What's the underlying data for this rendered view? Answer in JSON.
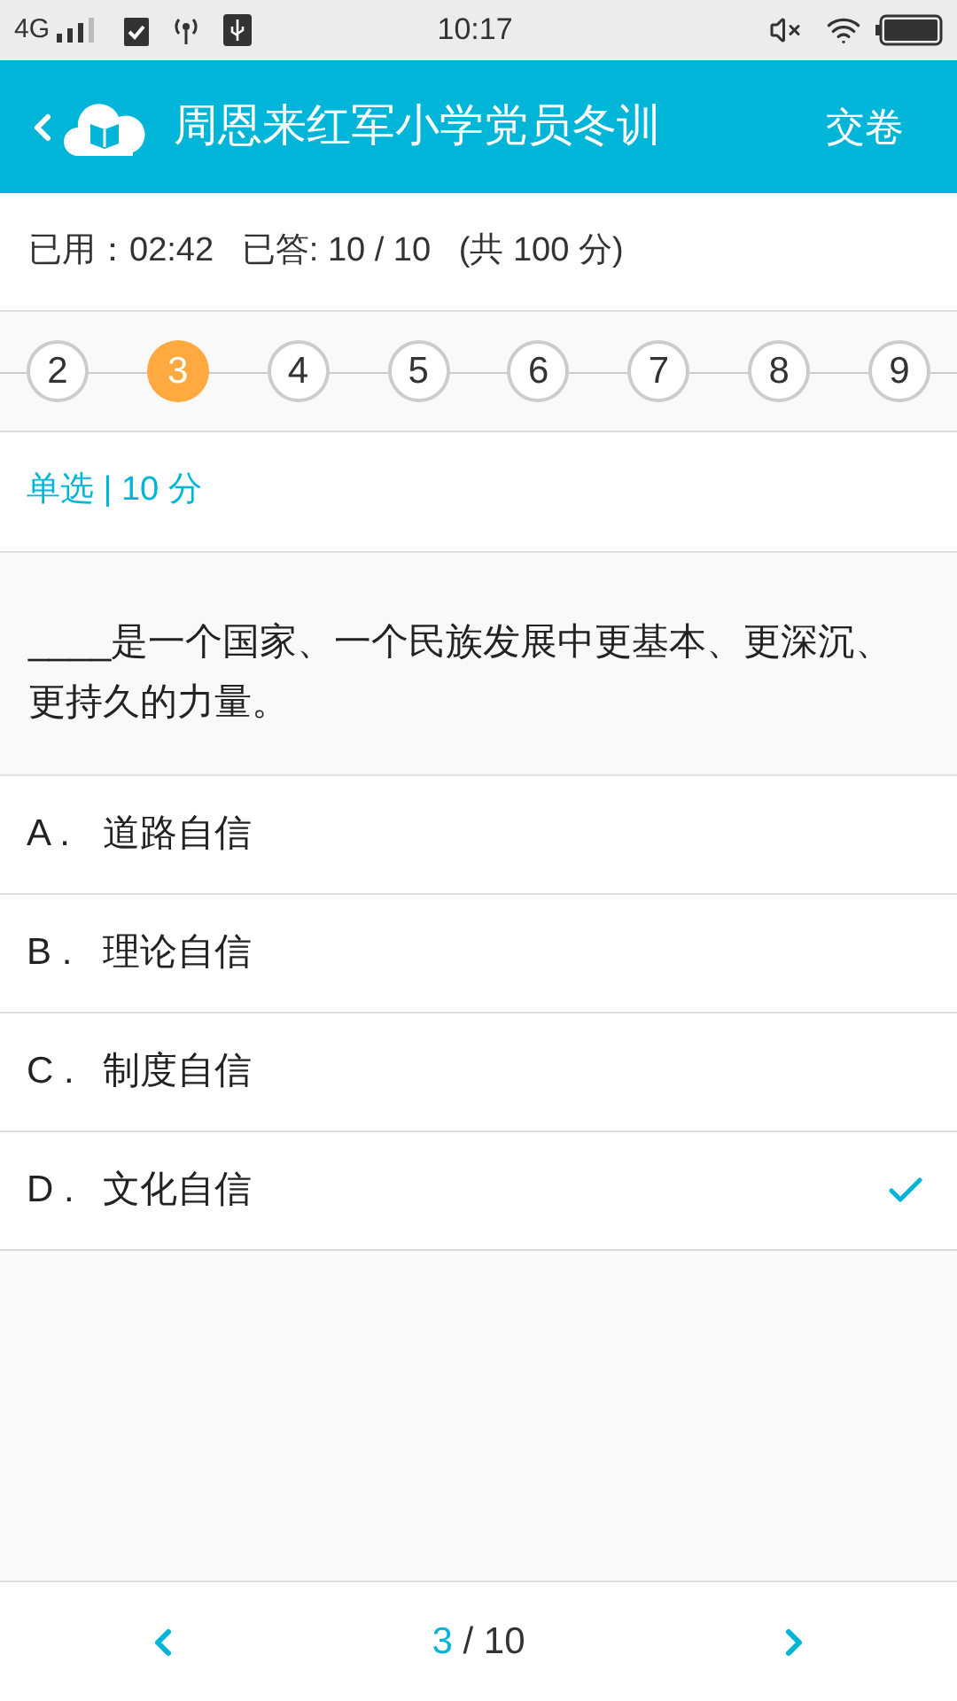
{
  "status_bar": {
    "network": "4G",
    "time": "10:17"
  },
  "header": {
    "title": "周恩来红军小学党员冬训",
    "action": "交卷"
  },
  "exam_info": "已用：02:42   已答: 10 / 10   (共 100 分)",
  "question_numbers": [
    {
      "label": "2",
      "selected": false
    },
    {
      "label": "3",
      "selected": true
    },
    {
      "label": "4",
      "selected": false
    },
    {
      "label": "5",
      "selected": false
    },
    {
      "label": "6",
      "selected": false
    },
    {
      "label": "7",
      "selected": false
    },
    {
      "label": "8",
      "selected": false
    },
    {
      "label": "9",
      "selected": false
    }
  ],
  "question_type": "单选 | 10 分",
  "question": "____是一个国家、一个民族发展中更基本、更深沉、更持久的力量。",
  "options": [
    {
      "letter": "A .",
      "text": "道路自信",
      "selected": false
    },
    {
      "letter": "B .",
      "text": "理论自信",
      "selected": false
    },
    {
      "letter": "C .",
      "text": "制度自信",
      "selected": false
    },
    {
      "letter": "D .",
      "text": "文化自信",
      "selected": true
    }
  ],
  "pager": {
    "current": "3",
    "rest": "/ 10"
  }
}
